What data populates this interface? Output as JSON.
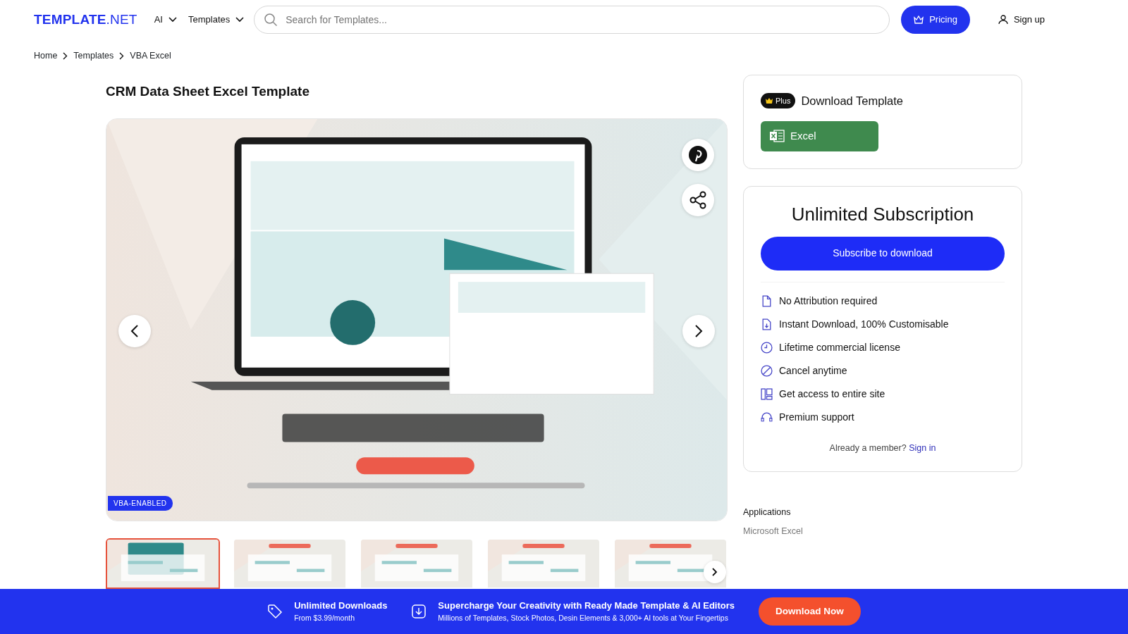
{
  "header": {
    "logo_bold": "TEMPLATE",
    "logo_rest": ".NET",
    "menus": [
      {
        "label": "AI"
      },
      {
        "label": "Templates"
      }
    ],
    "search": {
      "placeholder": "Search for Templates..."
    },
    "pricing": "Pricing",
    "signup": "Sign up"
  },
  "breadcrumb": [
    "Home",
    "Templates",
    "VBA Excel"
  ],
  "title": "CRM Data Sheet Excel Template",
  "preview": {
    "kind": "picture",
    "badge": "VBA-ENABLED"
  },
  "thumbnails": [
    {
      "selected": true
    },
    {
      "selected": false
    },
    {
      "selected": false
    },
    {
      "selected": false
    },
    {
      "selected": false
    }
  ],
  "download_card": {
    "badge": "Plus",
    "title": "Download Template",
    "formats": [
      {
        "label": "Excel"
      }
    ]
  },
  "subscription": {
    "title": "Unlimited Subscription",
    "button": "Subscribe to download",
    "features": [
      {
        "kind": "file",
        "text": "No Attribution required"
      },
      {
        "kind": "download",
        "text": "Instant Download, 100% Customisable"
      },
      {
        "kind": "clock",
        "text": "Lifetime commercial license"
      },
      {
        "kind": "cancel",
        "text": "Cancel anytime"
      },
      {
        "kind": "layout",
        "text": "Get access to entire site"
      },
      {
        "kind": "support",
        "text": "Premium support"
      }
    ],
    "member_text": "Already a member?",
    "signin": "Sign in"
  },
  "applications": {
    "label": "Applications",
    "value": "Microsoft Excel"
  },
  "banner": {
    "items": [
      {
        "kind": "tag",
        "title": "Unlimited Downloads",
        "subtitle": "From $3.99/month"
      },
      {
        "kind": "download",
        "title": "Supercharge Your Creativity with Ready Made Template & AI Editors",
        "subtitle": "Millions of Templates, Stock Photos, Desin Elements & 3,000+ AI tools at Your Fingertips"
      }
    ],
    "button": "Download Now"
  }
}
